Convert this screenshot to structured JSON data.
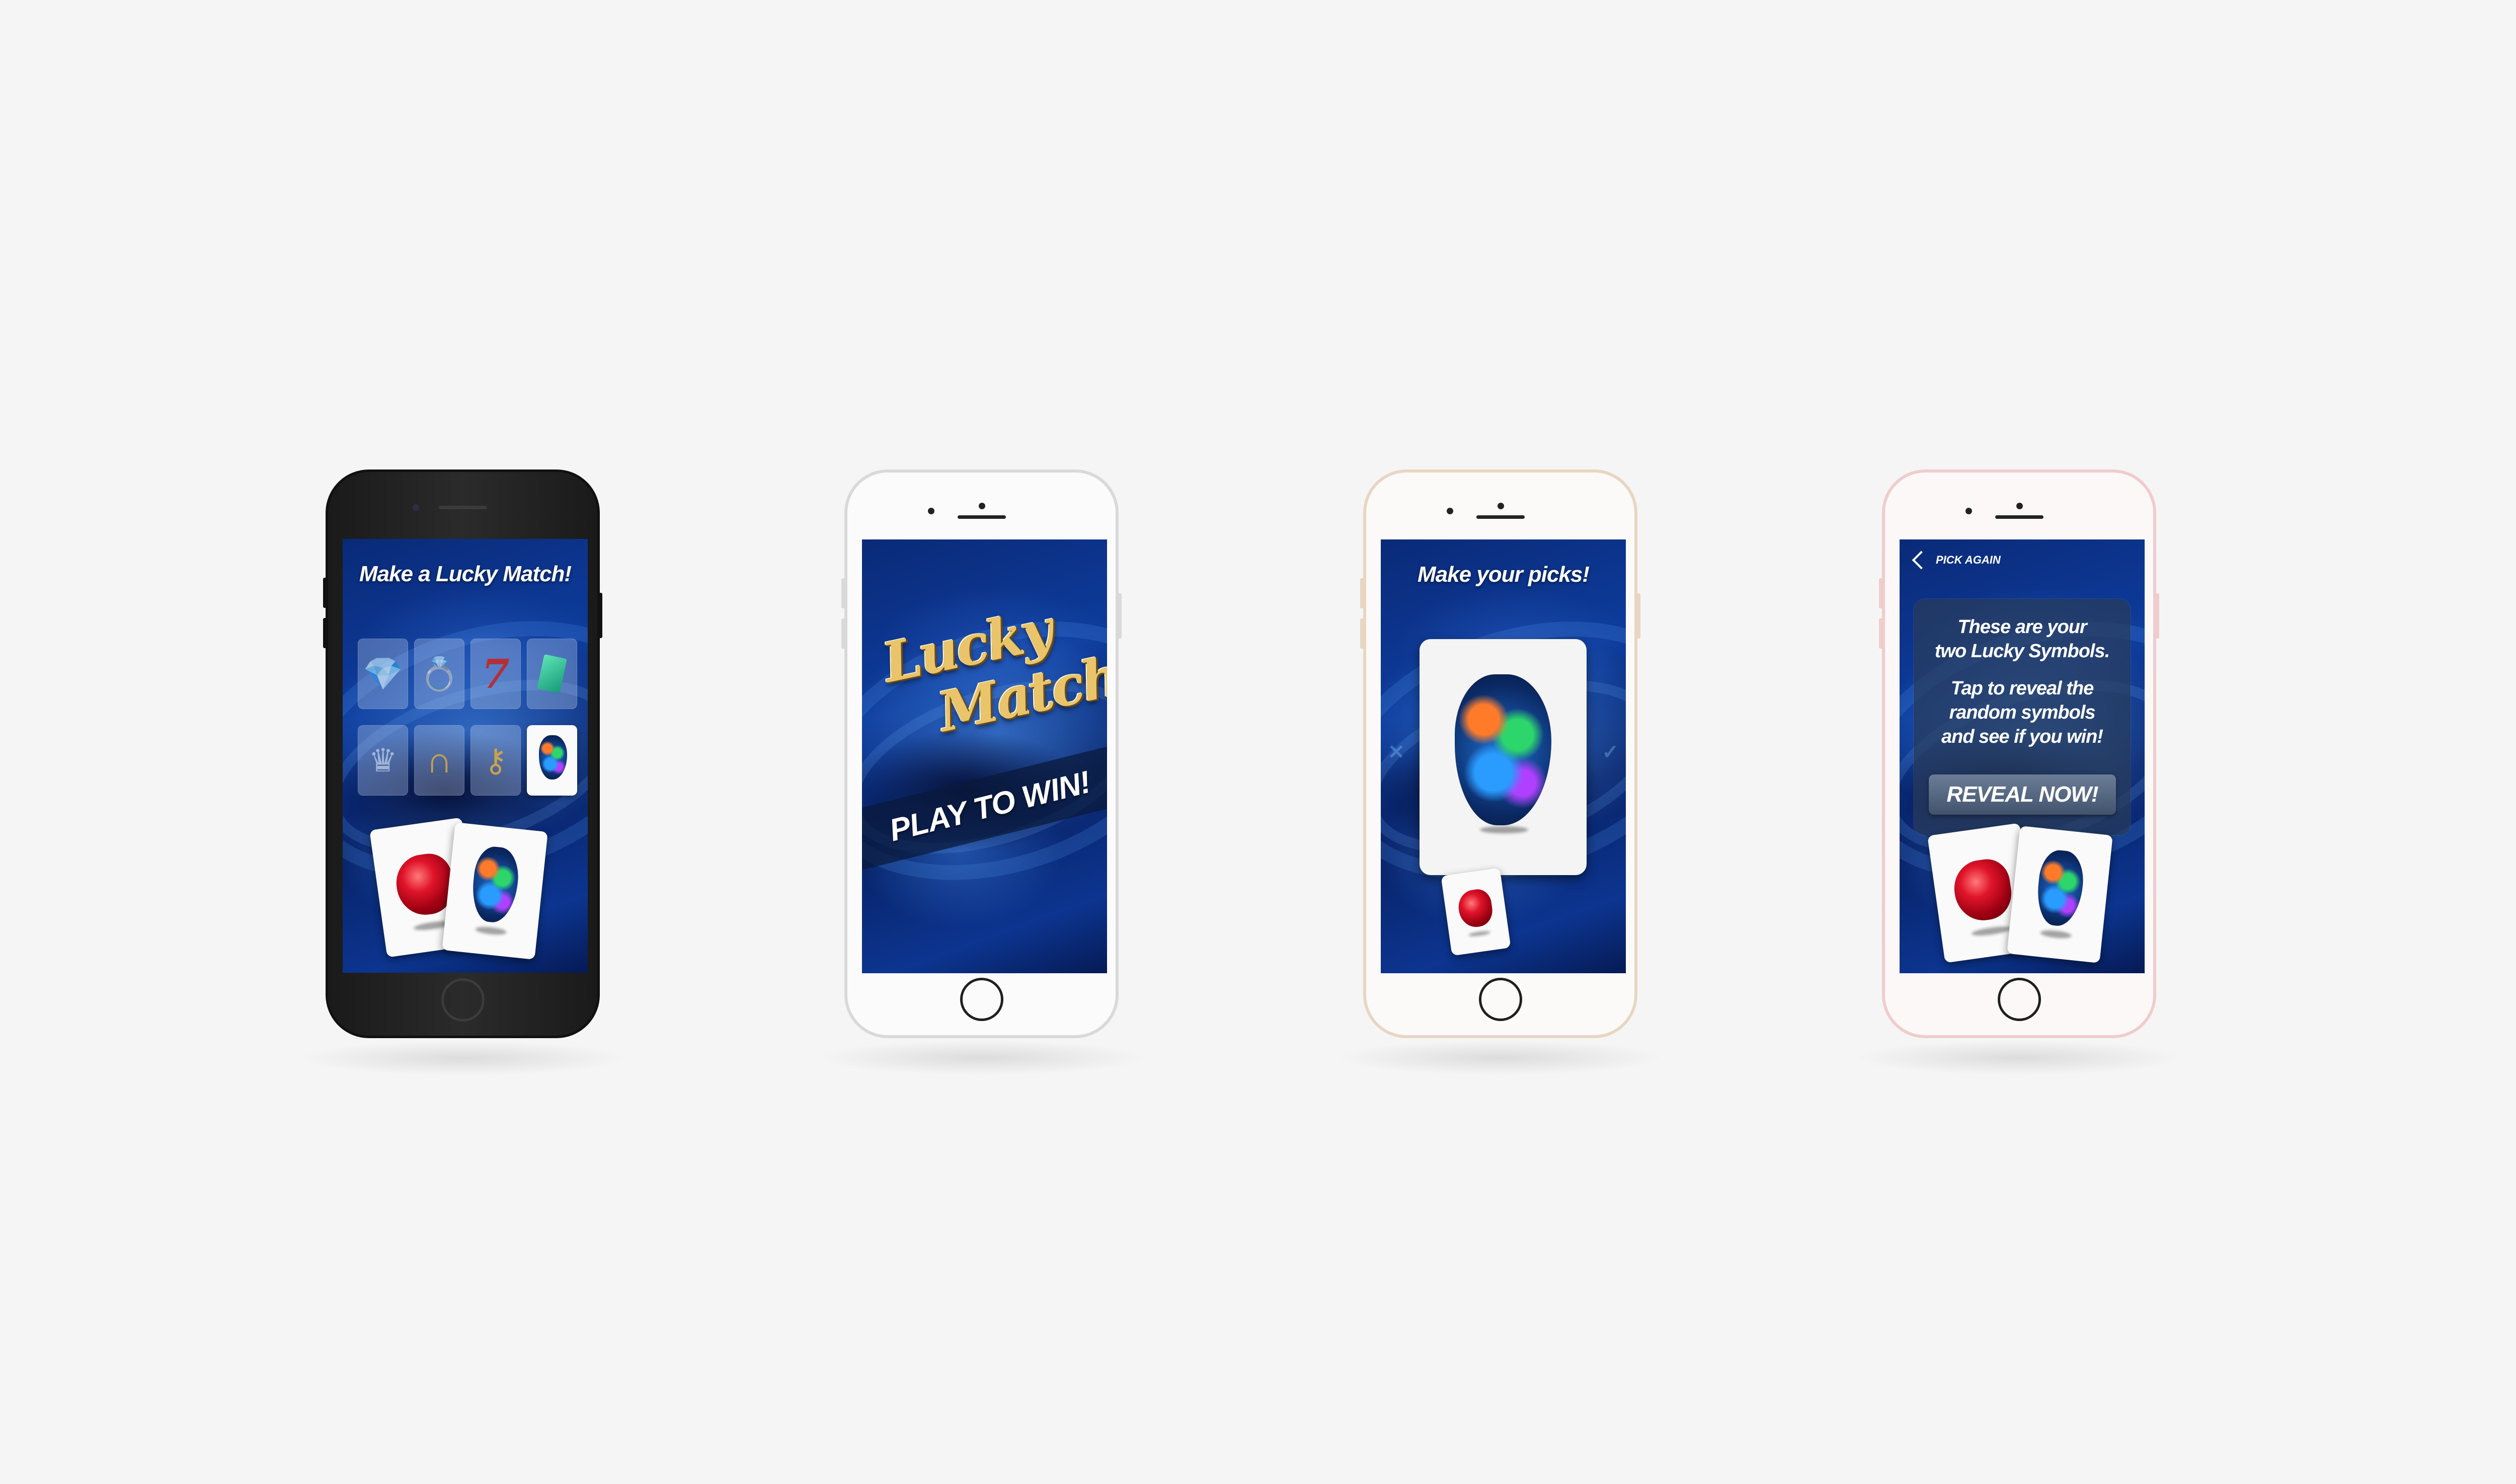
{
  "colors": {
    "background": "#f5f5f5",
    "screen_blue": "#0d3c9c",
    "card_white": "#fafafa",
    "logo_gold": "#e9c46a",
    "button_slate": "#5a6b85"
  },
  "phones": [
    {
      "finish": "black",
      "screen": {
        "title": "Make a Lucky Match!",
        "grid": [
          {
            "icon": "diamond-icon",
            "selected": false
          },
          {
            "icon": "ring-icon",
            "selected": false
          },
          {
            "icon": "lucky-seven-icon",
            "selected": false
          },
          {
            "icon": "emerald-icon",
            "selected": false
          },
          {
            "icon": "crown-icon",
            "selected": false
          },
          {
            "icon": "horseshoe-icon",
            "selected": false
          },
          {
            "icon": "key-icon",
            "selected": false
          },
          {
            "icon": "opal-icon",
            "selected": true
          }
        ],
        "picked_cards": [
          "ruby-icon",
          "opal-icon"
        ]
      }
    },
    {
      "finish": "silver",
      "screen": {
        "logo_line1": "Lucky",
        "logo_line2": "Match",
        "cta": "PLAY TO WIN!"
      }
    },
    {
      "finish": "gold",
      "screen": {
        "title": "Make your picks!",
        "current_card": "opal-icon",
        "picked_cards": [
          "ruby-icon"
        ]
      }
    },
    {
      "finish": "rose-gold",
      "screen": {
        "back_label": "PICK AGAIN",
        "info_line1": "These are your",
        "info_line2": "two Lucky Symbols.",
        "info_line3": "Tap to reveal the",
        "info_line4": "random symbols",
        "info_line5": "and see if you win!",
        "reveal_button": "REVEAL NOW!",
        "picked_cards": [
          "ruby-icon",
          "opal-icon"
        ]
      }
    }
  ]
}
